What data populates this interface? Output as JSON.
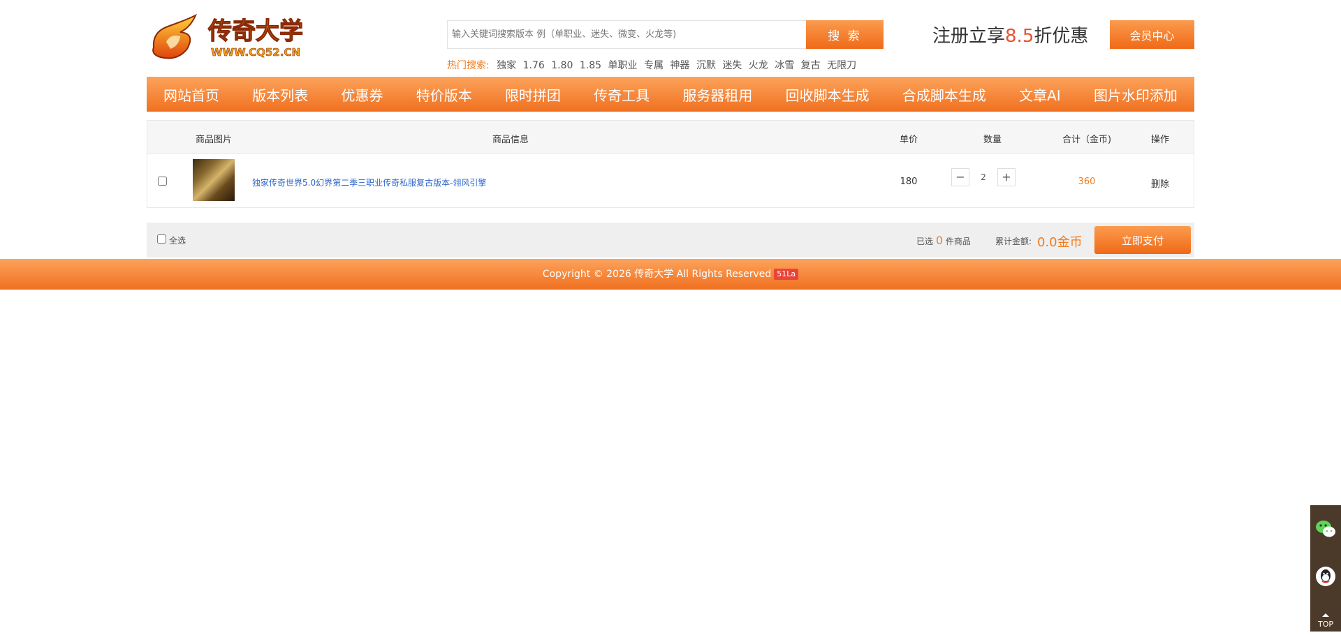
{
  "header": {
    "logo_text": "传奇大学",
    "logo_url_text": "WWW.CQ52.CN",
    "search": {
      "placeholder": "输入关键词搜索版本 例（单职业、迷失、微变、火龙等)",
      "button_label": "搜 索"
    },
    "hot": {
      "label": "热门搜索:",
      "items": [
        "独家",
        "1.76",
        "1.80",
        "1.85",
        "单职业",
        "专属",
        "神器",
        "沉默",
        "迷失",
        "火龙",
        "冰雪",
        "复古",
        "无限刀"
      ]
    },
    "promo": {
      "prefix": "注册立享",
      "number": "8.5",
      "suffix": "折优惠"
    },
    "member_button": "会员中心"
  },
  "nav": {
    "items": [
      "网站首页",
      "版本列表",
      "优惠券",
      "特价版本",
      "限时拼团",
      "传奇工具",
      "服务器租用",
      "回收脚本生成",
      "合成脚本生成",
      "文章AI",
      "图片水印添加"
    ]
  },
  "cart": {
    "headers": {
      "image": "商品图片",
      "info": "商品信息",
      "price": "单价",
      "qty": "数量",
      "total": "合计（金币)",
      "action": "操作"
    },
    "rows": [
      {
        "title": "独家传奇世界5.0幻界第二季三职业传奇私服复古版本-翎风引擎",
        "price": "180",
        "qty": "2",
        "subtotal": "360",
        "action": "删除"
      }
    ]
  },
  "summary": {
    "select_all": "全选",
    "selected_prefix": "已选",
    "selected_count": "0",
    "selected_suffix": "件商品",
    "total_label": "累计金额:",
    "total_value": "0.0金币",
    "pay_button": "立即支付"
  },
  "footer": {
    "copyright": "Copyright © 2026 传奇大学 All Rights Reserved",
    "badge": "51La"
  },
  "side": {
    "top_label": "TOP"
  },
  "colors": {
    "accent": "#f07b1e",
    "link": "#2a63c9",
    "promo": "#e8502e"
  }
}
